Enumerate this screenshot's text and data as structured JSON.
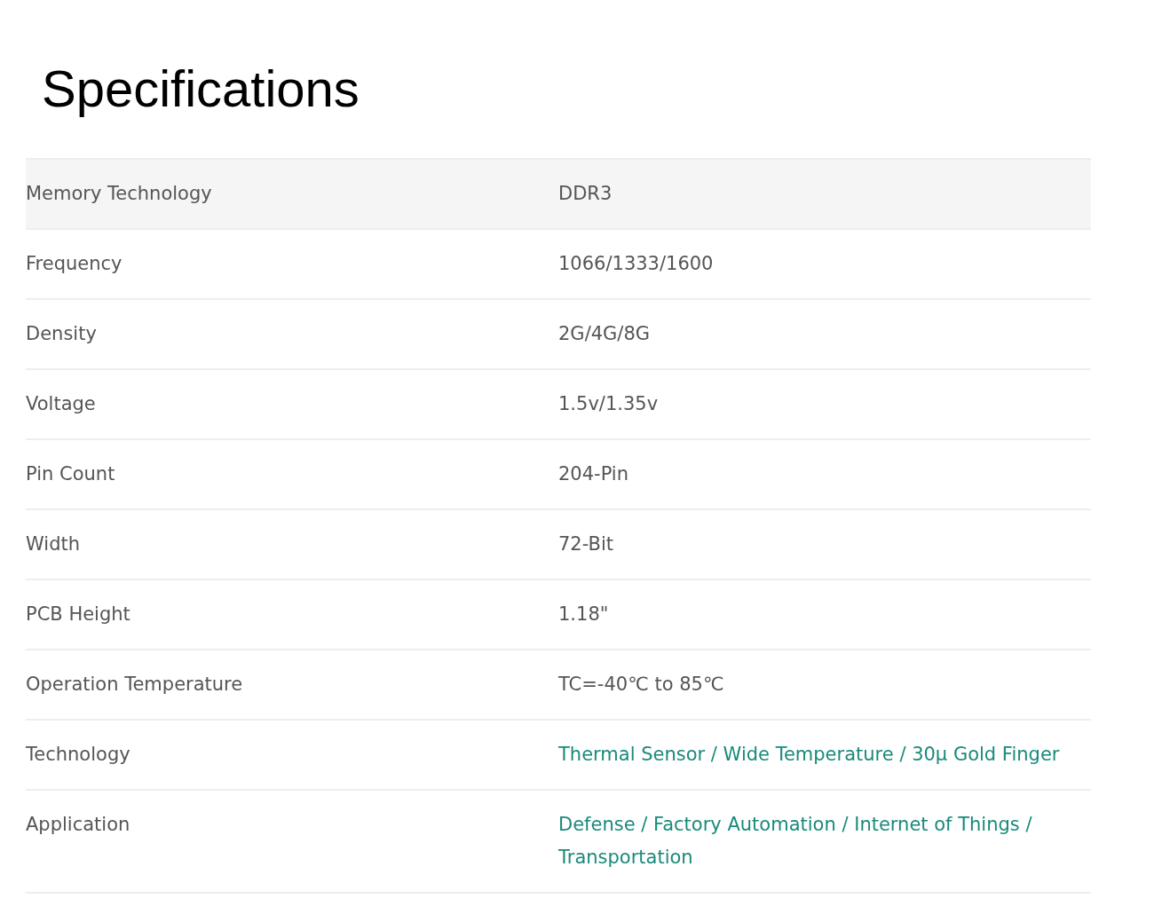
{
  "title": "Specifications",
  "rows": [
    {
      "label": "Memory Technology",
      "value": {
        "kind": "text",
        "text": "DDR3"
      }
    },
    {
      "label": "Frequency",
      "value": {
        "kind": "text",
        "text": "1066/1333/1600"
      }
    },
    {
      "label": "Density",
      "value": {
        "kind": "text",
        "text": "2G/4G/8G"
      }
    },
    {
      "label": "Voltage",
      "value": {
        "kind": "text",
        "text": "1.5v/1.35v"
      }
    },
    {
      "label": "Pin Count",
      "value": {
        "kind": "text",
        "text": "204-Pin"
      }
    },
    {
      "label": "Width",
      "value": {
        "kind": "text",
        "text": "72-Bit"
      }
    },
    {
      "label": "PCB Height",
      "value": {
        "kind": "text",
        "text": "1.18\""
      }
    },
    {
      "label": "Operation Temperature",
      "value": {
        "kind": "text",
        "text": "TC=-40℃ to 85℃"
      }
    },
    {
      "label": "Technology",
      "value": {
        "kind": "links",
        "separator": "/",
        "links": [
          "Thermal Sensor",
          "Wide Temperature",
          "30μ Gold Finger"
        ]
      }
    },
    {
      "label": "Application",
      "value": {
        "kind": "links",
        "separator": "/",
        "links": [
          "Defense",
          "Factory Automation",
          "Internet of Things",
          "Transportation"
        ]
      }
    }
  ]
}
